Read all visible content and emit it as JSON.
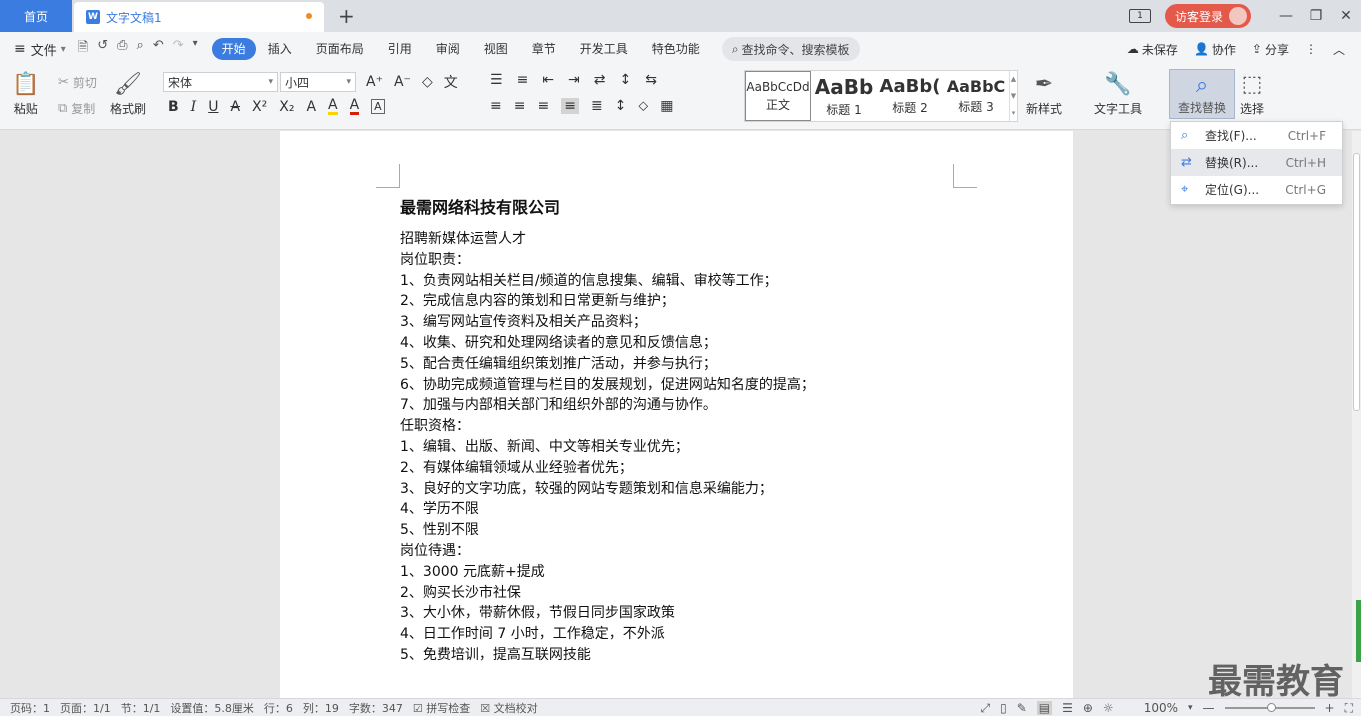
{
  "titlebar": {
    "home_tab": "首页",
    "doc_tab": "文字文稿1",
    "doc_icon": "W",
    "add_tab": "+",
    "layout_label": "1",
    "login": "访客登录",
    "minimize": "—",
    "restore": "❐",
    "close": "✕"
  },
  "menu": {
    "hamburger": "≡",
    "file": "文件",
    "file_arrow": "▾",
    "quick": [
      "🗎",
      "↺",
      "⎙",
      "⌕",
      "↶",
      "↷",
      "▾"
    ],
    "tabs": [
      "开始",
      "插入",
      "页面布局",
      "引用",
      "审阅",
      "视图",
      "章节",
      "开发工具",
      "特色功能"
    ],
    "search": "查找命令、搜索模板",
    "unsaved": "未保存",
    "collab": "协作",
    "share": "分享",
    "more": "⋮",
    "collapse": "︿"
  },
  "ribbon": {
    "paste": "粘贴",
    "cut": "剪切",
    "copy": "复制",
    "format_painter": "格式刷",
    "font_name": "宋体",
    "font_size": "小四",
    "font_size_up": "A⁺",
    "font_size_down": "A⁻",
    "clear": "◇",
    "phonetic": "文",
    "bold": "B",
    "italic": "I",
    "underline": "U",
    "strike": "A",
    "superscript": "X²",
    "subscript": "X₂",
    "text_effect": "A",
    "highlight": "A",
    "font_color": "A",
    "char_border": "A",
    "para_icons_row1": [
      "☰",
      "≡",
      "⇤",
      "⇥",
      "⇄",
      "↕",
      "⇆"
    ],
    "para_icons_row2": [
      "≡",
      "≡",
      "≡",
      "≡",
      "≣",
      "↕",
      "⬦",
      "▦"
    ],
    "styles": [
      {
        "preview": "AaBbCcDd",
        "name": "正文"
      },
      {
        "preview": "AaBb",
        "name": "标题 1"
      },
      {
        "preview": "AaBb(",
        "name": "标题 2"
      },
      {
        "preview": "AaBbC",
        "name": "标题 3"
      }
    ],
    "new_style": "新样式",
    "text_tools": "文字工具",
    "find_replace": "查找替换",
    "select": "选择"
  },
  "dropdown": {
    "items": [
      {
        "label": "查找(F)...",
        "shortcut": "Ctrl+F",
        "icon": "⌕"
      },
      {
        "label": "替换(R)...",
        "shortcut": "Ctrl+H",
        "icon": "⇄"
      },
      {
        "label": "定位(G)...",
        "shortcut": "Ctrl+G",
        "icon": "⌖"
      }
    ]
  },
  "document": {
    "title": "最需网络科技有限公司",
    "lines": [
      "招聘新媒体运营人才",
      "岗位职责：",
      "1、负责网站相关栏目/频道的信息搜集、编辑、审校等工作；",
      "2、完成信息内容的策划和日常更新与维护；",
      "3、编写网站宣传资料及相关产品资料；",
      "4、收集、研究和处理网络读者的意见和反馈信息；",
      "5、配合责任编辑组织策划推广活动，并参与执行；",
      "6、协助完成频道管理与栏目的发展规划，促进网站知名度的提高；",
      "7、加强与内部相关部门和组织外部的沟通与协作。",
      "任职资格：",
      "1、编辑、出版、新闻、中文等相关专业优先；",
      "2、有媒体编辑领域从业经验者优先；",
      "3、良好的文字功底，较强的网站专题策划和信息采编能力；",
      "4、学历不限",
      "5、性别不限",
      "岗位待遇：",
      "1、3000 元底薪+提成",
      "2、购买长沙市社保",
      "3、大小休，带薪休假，节假日同步国家政策",
      "4、日工作时间 7 小时，工作稳定，不外派",
      "5、免费培训，提高互联网技能"
    ]
  },
  "watermark": "最需教育",
  "statusbar": {
    "page": "页码：1",
    "pages": "页面：1/1",
    "section": "节：1/1",
    "setting": "设置值：5.8厘米",
    "row": "行：6",
    "col": "列：19",
    "wordcount": "字数：347",
    "spellcheck": "拼写检查",
    "doccheck": "文档校对",
    "zoom": "100%",
    "zoom_minus": "—",
    "zoom_plus": "+"
  },
  "colors": {
    "accent": "#3b7ce0",
    "login": "#e45a4a",
    "unsaved_dot": "#f08a24"
  }
}
